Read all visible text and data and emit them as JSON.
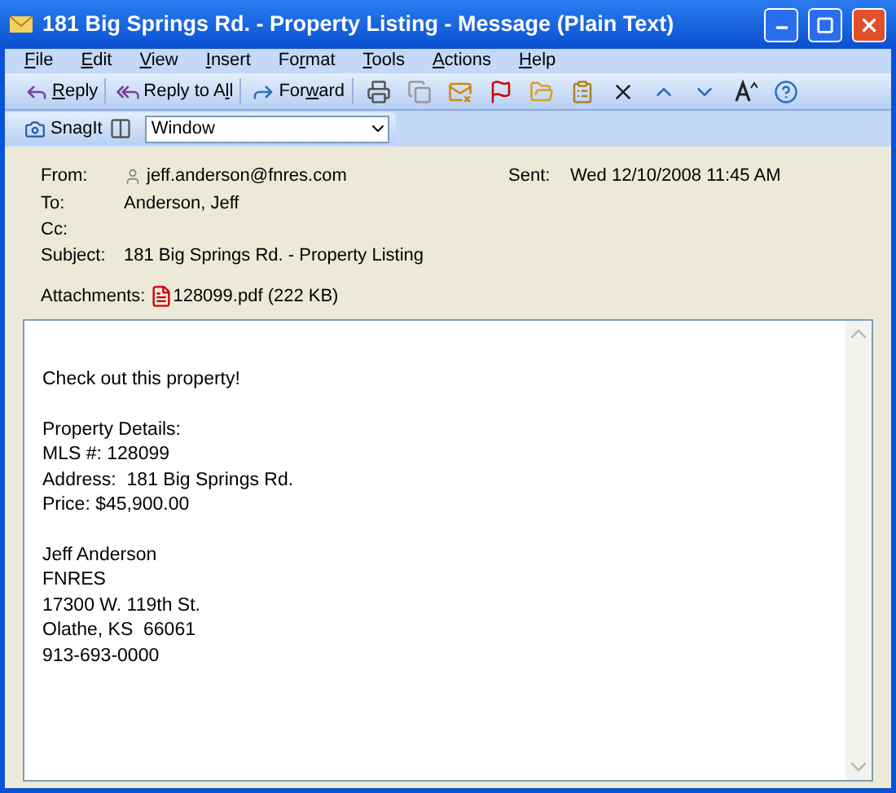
{
  "window": {
    "title": "181 Big Springs Rd. - Property Listing - Message (Plain Text)"
  },
  "menu": [
    {
      "key": "F",
      "post": "ile"
    },
    {
      "key": "E",
      "post": "dit"
    },
    {
      "key": "V",
      "post": "iew"
    },
    {
      "key": "I",
      "post": "nsert"
    },
    {
      "pre": "Fo",
      "key": "r",
      "post": "mat"
    },
    {
      "key": "T",
      "post": "ools"
    },
    {
      "key": "A",
      "post": "ctions"
    },
    {
      "key": "H",
      "post": "elp"
    }
  ],
  "toolbar": [
    {
      "key": "R",
      "post": "eply"
    },
    {
      "pre": "Reply to A",
      "key": "l",
      "post": "l"
    },
    {
      "pre": "For",
      "key": "w",
      "post": "ard"
    }
  ],
  "snagit": {
    "label": "SnagIt",
    "dropdown_value": "Window"
  },
  "header": {
    "from_label": "From:",
    "from": "jeff.anderson@fnres.com",
    "sent_label": "Sent:",
    "sent": "Wed 12/10/2008 11:45 AM",
    "fields": [
      {
        "label": "To:",
        "value": "Anderson, Jeff"
      },
      {
        "label": "Cc:"
      },
      {
        "label": "Subject:",
        "value": "181 Big Springs Rd. - Property Listing"
      }
    ],
    "attachments_label": "Attachments:",
    "attachment": "128099.pdf (222 KB)"
  },
  "body": {
    "paragraphs": [
      [
        "Check out this property!"
      ],
      [
        "Property Details:",
        "MLS #: 128099",
        "Address:  181 Big Springs Rd.",
        "Price: $45,900.00"
      ],
      [
        "Jeff Anderson",
        "FNRES",
        "17300 W. 119th St.",
        "Olathe, KS  66061",
        "913-693-0000"
      ]
    ]
  }
}
